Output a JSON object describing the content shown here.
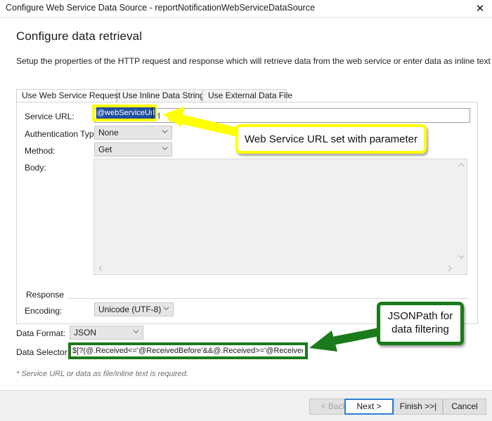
{
  "window": {
    "title": "Configure Web Service Data Source - reportNotificationWebServiceDataSource",
    "close_label": "✕"
  },
  "page": {
    "heading": "Configure data retrieval",
    "description": "Setup the properties of the HTTP request and response which will retrieve data from the web service or enter data as inline text or file."
  },
  "tabs": [
    {
      "label": "Use Web Service Request",
      "active": true
    },
    {
      "label": "Use Inline Data String",
      "active": false
    },
    {
      "label": "Use External Data File",
      "active": false
    }
  ],
  "request": {
    "service_url": {
      "label": "Service URL:",
      "value": "@webServiceUrl",
      "placeholder": ""
    },
    "authentication_type": {
      "label": "Authentication Type:",
      "value": "None"
    },
    "method": {
      "label": "Method:",
      "value": "Get"
    },
    "body": {
      "label": "Body:",
      "value": "",
      "placeholder": ""
    }
  },
  "response": {
    "caption": "Response",
    "encoding": {
      "label": "Encoding:",
      "value": "Unicode (UTF-8)"
    }
  },
  "data": {
    "format": {
      "label": "Data Format:",
      "value": "JSON"
    },
    "selector": {
      "label": "Data Selector:",
      "value": "$[?(@.Received<='@ReceivedBefore'&&@.Received>='@ReceivedAfter')]",
      "placeholder": ""
    }
  },
  "note": "* Service URL or data as file/inline text is required.",
  "footer": {
    "back": "< Back",
    "next": "Next >",
    "finish": "Finish >>|",
    "cancel": "Cancel"
  },
  "annotations": [
    {
      "text": "Web Service URL set with parameter",
      "color": "#ffff00"
    },
    {
      "text": "JSONPath for\ndata filtering",
      "line1": "JSONPath for",
      "line2": "data filtering",
      "color": "#1b7a1b"
    }
  ],
  "colors": {
    "annotation_yellow": "#ffff00",
    "annotation_green": "#1b7a1b",
    "focus_blue": "#2a7fd4",
    "selection_blue": "#1f4fa0"
  }
}
